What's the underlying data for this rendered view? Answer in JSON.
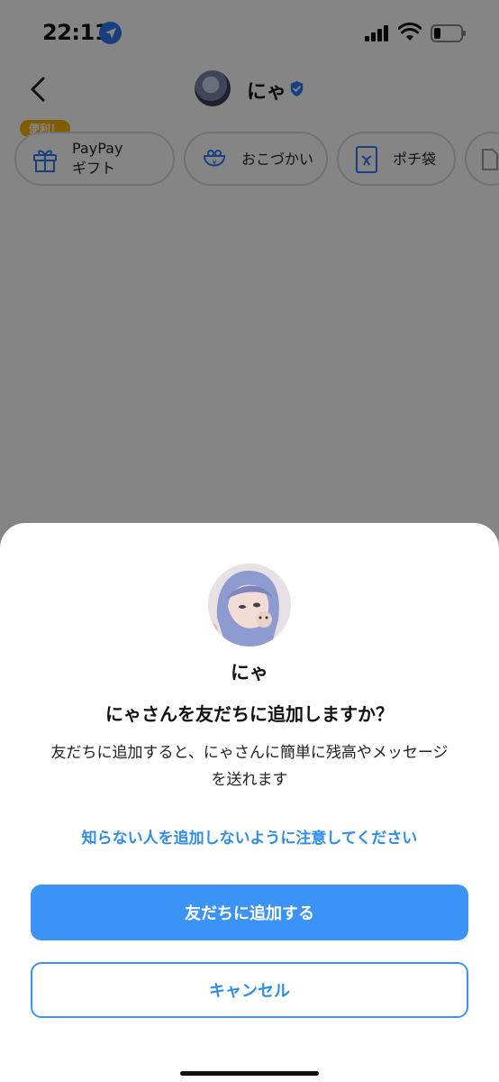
{
  "status_bar": {
    "time": "22:11"
  },
  "header": {
    "name": "にゃ"
  },
  "chips": {
    "badge": "便利！",
    "paypay_gift": {
      "line1": "PayPay",
      "line2": "ギフト"
    },
    "okozukai": "おこづかい",
    "pochibukuro": "ポチ袋"
  },
  "sheet": {
    "name": "にゃ",
    "title": "にゃさんを友だちに追加しますか？",
    "description_line1": "友だちに追加すると、にゃさんに簡単に残高やメッセージ",
    "description_line2": "を送れます",
    "warning_link": "知らない人を追加しないように注意してください",
    "add_button": "友だちに追加する",
    "cancel_button": "キャンセル"
  },
  "colors": {
    "accent": "#3b93f6",
    "link": "#2f8de8",
    "badge": "#f6b500",
    "verified": "#2f7cf6"
  }
}
